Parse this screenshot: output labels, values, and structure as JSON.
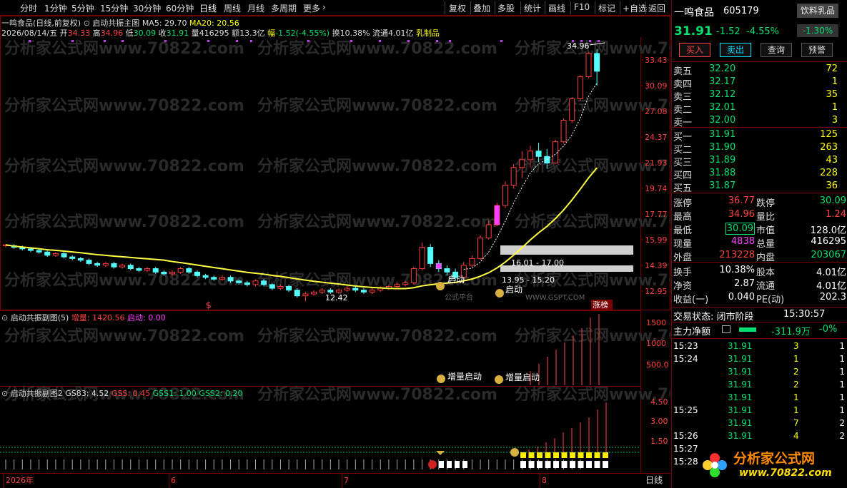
{
  "period_tabs": [
    "分时",
    "1分钟",
    "5分钟",
    "15分钟",
    "30分钟",
    "60分钟",
    "日线",
    "周线",
    "月线",
    "多周期",
    "更多"
  ],
  "toolbar": [
    "复权",
    "叠加",
    "多股",
    "统计",
    "画线",
    "F10",
    "标记",
    "+自选",
    "返回"
  ],
  "header": {
    "stock_title": "一鸣食品(日线,前复权)",
    "indicator_name": "启动共振主图",
    "ma5": "MA5: 29.70",
    "ma20": "MA20: 20.56"
  },
  "ohlc": {
    "date": "2026/08/14/五",
    "open_label": "开",
    "open": "34.33",
    "high_label": "高",
    "high": "34.96",
    "low_label": "低",
    "low": "30.09",
    "close_label": "收",
    "close": "31.91",
    "volume_label": "量",
    "volume": "416295",
    "amount_label": "额",
    "amount": "13.3亿",
    "change_label": "幅",
    "change": "-1.52(-4.55%)",
    "turnover_label": "换",
    "turnover": "10.38%",
    "float_label": "流通",
    "float": "4.01亿",
    "sector": "乳制品"
  },
  "price_axis": [
    "33.43",
    "30.09",
    "27.08",
    "24.37",
    "21.93",
    "19.74",
    "17.77",
    "15.99",
    "14.39",
    "12.95"
  ],
  "annotations": {
    "peak": "34.96",
    "low": "12.42",
    "zone1": "16.01 - 17.00",
    "zone2": "13.95 - 15.20",
    "start1": "启动",
    "start2": "启动",
    "limit_up": "涨榜",
    "dollar": "$",
    "platform_note": "公式平台"
  },
  "watermark": "分析家公式网www.70822.com",
  "watermark2": "WWW.GSPT.COM",
  "sub1": {
    "title": "启动共振副图(5)",
    "label1": "增量: 1420.56",
    "label2": "启动: 0.00",
    "axis": [
      "1500",
      "1000",
      "500.0"
    ],
    "mark1": "增量启动",
    "mark2": "增量启动"
  },
  "sub2": {
    "title": "启动共振副图2",
    "gs83": "GS83: 4.52",
    "gss": "GSS: 0.45",
    "gss1": "GSS1: 1.00",
    "gss2": "GSS2: 0.20",
    "axis": [
      "4.50",
      "3.00",
      "1.50"
    ]
  },
  "time_axis": [
    "2026年",
    "6",
    "7",
    "8"
  ],
  "period_label": "日线",
  "quote": {
    "name": "一鸣食品",
    "code": "605179",
    "sector_badge": "饮料乳品",
    "sector_change": "-1.30%",
    "price": "31.91",
    "change": "-1.52",
    "change_pct": "-4.55%",
    "buttons": [
      "买入",
      "卖出",
      "查询",
      "预警"
    ],
    "asks": [
      {
        "label": "卖五",
        "price": "32.20",
        "vol": "72"
      },
      {
        "label": "卖四",
        "price": "32.17",
        "vol": "1"
      },
      {
        "label": "卖三",
        "price": "32.12",
        "vol": "35"
      },
      {
        "label": "卖二",
        "price": "32.01",
        "vol": "1"
      },
      {
        "label": "卖一",
        "price": "32.00",
        "vol": "3"
      }
    ],
    "bids": [
      {
        "label": "买一",
        "price": "31.91",
        "vol": "125"
      },
      {
        "label": "买二",
        "price": "31.90",
        "vol": "263"
      },
      {
        "label": "买三",
        "price": "31.89",
        "vol": "43"
      },
      {
        "label": "买四",
        "price": "31.88",
        "vol": "228"
      },
      {
        "label": "买五",
        "price": "31.87",
        "vol": "36"
      }
    ],
    "stats": [
      {
        "l1": "涨停",
        "v1": "36.77",
        "l2": "跌停",
        "v2": "30.09"
      },
      {
        "l1": "最高",
        "v1": "34.96",
        "l2": "量比",
        "v2": "1.24"
      },
      {
        "l1": "最低",
        "v1": "30.09",
        "l2": "市值",
        "v2": "128.0亿"
      },
      {
        "l1": "现量",
        "v1": "4838",
        "l2": "总量",
        "v2": "416295"
      },
      {
        "l1": "外盘",
        "v1": "213228",
        "l2": "内盘",
        "v2": "203067"
      }
    ],
    "stats2": [
      {
        "l1": "换手",
        "v1": "10.38%",
        "l2": "股本",
        "v2": "4.01亿"
      },
      {
        "l1": "净资",
        "v1": "2.87",
        "l2": "流通",
        "v2": "4.01亿"
      },
      {
        "l1": "收益(一)",
        "v1": "0.040",
        "l2": "PE(动)",
        "v2": "202.3"
      }
    ],
    "trade_status": "交易状态: 闭市阶段",
    "trade_time": "15:30:57",
    "main_flow_label": "主力净额",
    "main_flow_value": "-311.9万",
    "main_flow_pct": "-0%",
    "ticks": [
      {
        "t": "15:23",
        "p": "31.91",
        "v": "3",
        "n": "1"
      },
      {
        "t": "15:24",
        "p": "31.91",
        "v": "1",
        "n": "1"
      },
      {
        "t": "",
        "p": "31.91",
        "v": "2",
        "n": "1"
      },
      {
        "t": "",
        "p": "31.91",
        "v": "2",
        "n": "1"
      },
      {
        "t": "",
        "p": "31.91",
        "v": "1",
        "n": "1"
      },
      {
        "t": "15:25",
        "p": "31.91",
        "v": "1",
        "n": "1"
      },
      {
        "t": "",
        "p": "31.91",
        "v": "7",
        "n": "2"
      },
      {
        "t": "15:26",
        "p": "31.91",
        "v": "4",
        "n": "2"
      },
      {
        "t": "15:27",
        "p": "31.91",
        "v": "",
        "n": ""
      },
      {
        "t": "15:28",
        "p": "",
        "v": "",
        "n": ""
      }
    ],
    "logo_text": "分析家公式网",
    "logo_url": "www.70822.com"
  },
  "chart_data": {
    "type": "candlestick",
    "price_axis_ticks": [
      33.43,
      30.09,
      27.08,
      24.37,
      21.93,
      19.74,
      17.77,
      15.99,
      14.39,
      12.95
    ],
    "candles": [
      [
        15.6,
        15.7,
        15.5,
        15.65
      ],
      [
        15.6,
        15.7,
        15.4,
        15.5
      ],
      [
        15.5,
        15.6,
        15.3,
        15.4
      ],
      [
        15.4,
        15.5,
        15.2,
        15.3
      ],
      [
        15.3,
        15.4,
        15.1,
        15.2
      ],
      [
        15.2,
        15.3,
        14.9,
        15.0
      ],
      [
        15.0,
        15.2,
        14.9,
        15.1
      ],
      [
        15.1,
        15.2,
        14.8,
        14.9
      ],
      [
        14.9,
        15.0,
        14.7,
        14.8
      ],
      [
        14.8,
        14.9,
        14.6,
        14.7
      ],
      [
        14.7,
        14.8,
        14.4,
        14.5
      ],
      [
        14.5,
        14.6,
        14.3,
        14.4
      ],
      [
        14.4,
        14.6,
        14.3,
        14.5
      ],
      [
        14.5,
        14.6,
        14.2,
        14.3
      ],
      [
        14.3,
        14.5,
        14.2,
        14.4
      ],
      [
        14.4,
        14.5,
        14.1,
        14.2
      ],
      [
        14.2,
        14.3,
        14.0,
        14.1
      ],
      [
        14.1,
        14.3,
        14.0,
        14.2
      ],
      [
        14.2,
        14.3,
        13.9,
        14.0
      ],
      [
        14.0,
        14.1,
        13.8,
        13.9
      ],
      [
        13.9,
        14.1,
        13.8,
        14.0
      ],
      [
        14.0,
        14.3,
        13.9,
        14.2
      ],
      [
        14.2,
        14.3,
        13.9,
        14.0
      ],
      [
        14.0,
        14.1,
        13.7,
        13.8
      ],
      [
        13.8,
        13.9,
        13.6,
        13.7
      ],
      [
        13.7,
        13.8,
        13.5,
        13.6
      ],
      [
        13.6,
        13.8,
        13.5,
        13.7
      ],
      [
        13.7,
        13.8,
        13.4,
        13.5
      ],
      [
        13.5,
        13.6,
        13.3,
        13.4
      ],
      [
        13.4,
        13.5,
        13.2,
        13.3
      ],
      [
        13.3,
        13.6,
        13.2,
        13.5
      ],
      [
        13.5,
        13.6,
        13.2,
        13.3
      ],
      [
        13.3,
        13.4,
        13.0,
        13.1
      ],
      [
        13.1,
        13.3,
        13.0,
        13.2
      ],
      [
        13.2,
        13.3,
        12.9,
        13.0
      ],
      [
        13.0,
        13.1,
        12.6,
        12.7
      ],
      [
        12.7,
        12.9,
        12.42,
        12.8
      ],
      [
        12.8,
        13.0,
        12.7,
        12.9
      ],
      [
        12.9,
        13.1,
        12.8,
        13.0
      ],
      [
        13.0,
        13.1,
        12.8,
        12.9
      ],
      [
        12.9,
        13.1,
        12.8,
        13.0
      ],
      [
        13.0,
        13.2,
        12.9,
        13.1
      ],
      [
        13.1,
        13.2,
        12.9,
        13.0
      ],
      [
        13.0,
        13.1,
        12.8,
        12.9
      ],
      [
        12.9,
        13.1,
        12.8,
        13.0
      ],
      [
        13.0,
        13.2,
        12.9,
        13.1
      ],
      [
        13.1,
        13.3,
        13.0,
        13.2
      ],
      [
        13.2,
        13.4,
        13.1,
        13.3
      ],
      [
        13.3,
        13.5,
        13.2,
        13.4
      ],
      [
        13.4,
        14.3,
        13.3,
        14.2
      ],
      [
        14.2,
        15.8,
        14.1,
        15.5
      ],
      [
        15.5,
        15.7,
        14.3,
        14.5
      ],
      [
        14.5,
        14.7,
        14.0,
        14.2
      ],
      [
        14.2,
        14.4,
        13.8,
        14.0
      ],
      [
        14.0,
        14.2,
        13.5,
        13.7
      ],
      [
        13.7,
        14.6,
        13.6,
        14.4
      ],
      [
        14.4,
        15.0,
        14.3,
        14.8
      ],
      [
        14.8,
        16.3,
        14.7,
        16.1
      ],
      [
        16.1,
        17.3,
        16.0,
        17.0
      ],
      [
        17.0,
        18.6,
        16.9,
        18.4
      ],
      [
        18.4,
        20.3,
        18.2,
        20.0
      ],
      [
        20.0,
        21.8,
        19.7,
        21.5
      ],
      [
        21.5,
        23.0,
        20.6,
        22.2
      ],
      [
        22.2,
        23.5,
        21.5,
        23.0
      ],
      [
        23.0,
        23.8,
        22.0,
        22.5
      ],
      [
        22.5,
        23.2,
        21.4,
        21.9
      ],
      [
        21.9,
        24.1,
        21.8,
        23.9
      ],
      [
        23.9,
        26.3,
        23.7,
        26.1
      ],
      [
        26.1,
        28.7,
        25.8,
        28.5
      ],
      [
        28.5,
        31.4,
        28.3,
        31.2
      ],
      [
        31.2,
        34.5,
        31.0,
        34.33
      ],
      [
        34.33,
        34.96,
        30.09,
        31.91
      ]
    ]
  }
}
